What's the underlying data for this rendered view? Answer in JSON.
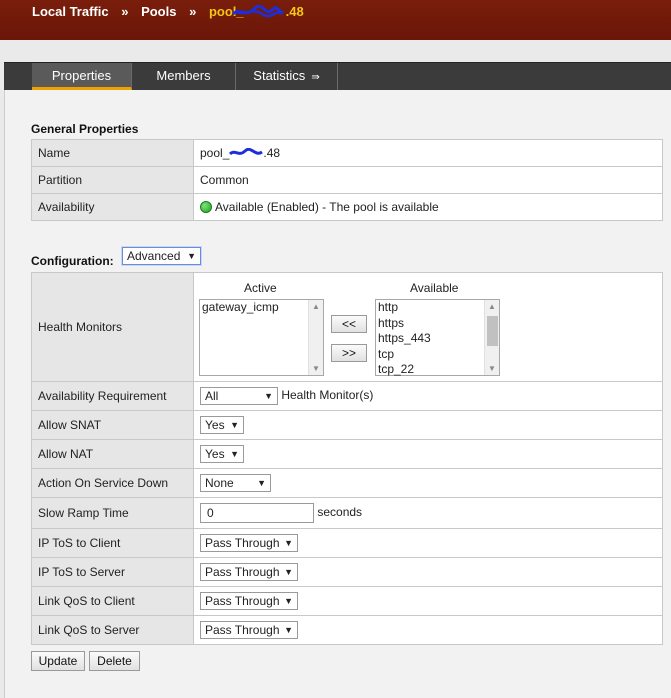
{
  "breadcrumb": {
    "items": [
      "Local Traffic",
      "Pools"
    ],
    "separator": "»",
    "current": "pool_",
    "current_suffix": ".48"
  },
  "tabs": [
    {
      "label": "Properties",
      "active": true
    },
    {
      "label": "Members",
      "active": false
    },
    {
      "label": "Statistics",
      "active": false,
      "icon": "popout-arrow-icon"
    }
  ],
  "general": {
    "title": "General Properties",
    "name_label": "Name",
    "name_value_prefix": "pool_",
    "name_value_suffix": ".48",
    "partition_label": "Partition",
    "partition_value": "Common",
    "availability_label": "Availability",
    "availability_value": "Available (Enabled) - The pool is available",
    "availability_status_color": "#1fa31f"
  },
  "configuration": {
    "title": "Configuration:",
    "mode": "Advanced",
    "health_monitors": {
      "label": "Health Monitors",
      "active_header": "Active",
      "available_header": "Available",
      "active": [
        "gateway_icmp"
      ],
      "available": [
        "http",
        "https",
        "https_443",
        "tcp",
        "tcp_22"
      ],
      "add_label": "<<",
      "remove_label": ">>"
    },
    "rows": {
      "availability_requirement": {
        "label": "Availability Requirement",
        "value": "All",
        "suffix": "Health Monitor(s)"
      },
      "allow_snat": {
        "label": "Allow SNAT",
        "value": "Yes"
      },
      "allow_nat": {
        "label": "Allow NAT",
        "value": "Yes"
      },
      "action_on_service_down": {
        "label": "Action On Service Down",
        "value": "None"
      },
      "slow_ramp_time": {
        "label": "Slow Ramp Time",
        "value": "0",
        "suffix": "seconds"
      },
      "ip_tos_client": {
        "label": "IP ToS to Client",
        "value": "Pass Through"
      },
      "ip_tos_server": {
        "label": "IP ToS to Server",
        "value": "Pass Through"
      },
      "link_qos_client": {
        "label": "Link QoS to Client",
        "value": "Pass Through"
      },
      "link_qos_server": {
        "label": "Link QoS to Server",
        "value": "Pass Through"
      }
    }
  },
  "actions": {
    "update_label": "Update",
    "delete_label": "Delete"
  },
  "colors": {
    "header_bg": "#6e1a0a",
    "tab_accent": "#f0a300",
    "breadcrumb_current": "#f5c518"
  }
}
